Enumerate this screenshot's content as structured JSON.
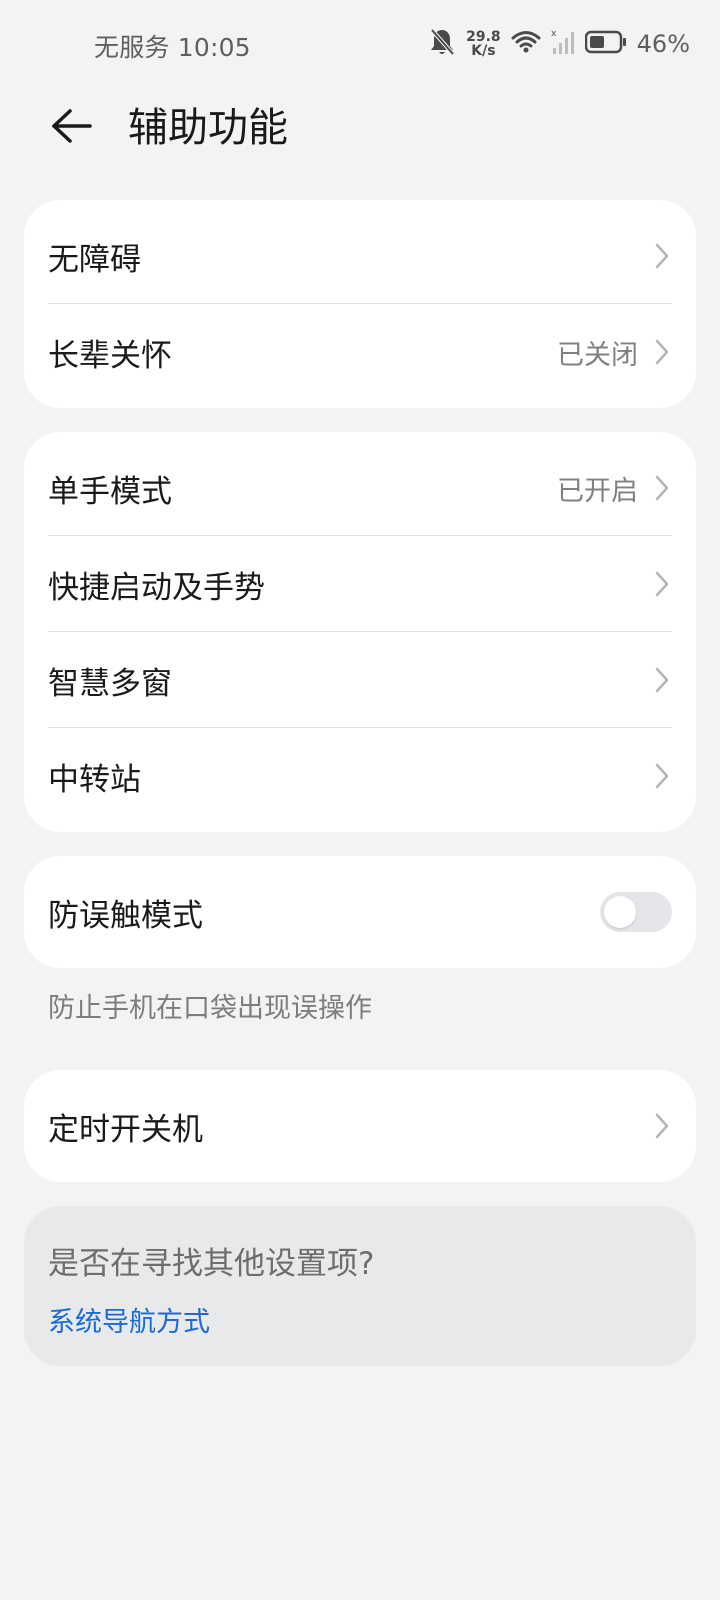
{
  "status_bar": {
    "left_text": "无服务 10:05",
    "net_speed_value": "29.8",
    "net_speed_unit": "K/s",
    "battery_percent": "46%",
    "icons": [
      "bell-muted-icon",
      "wifi-icon",
      "signal-icon",
      "battery-icon"
    ]
  },
  "header": {
    "title": "辅助功能"
  },
  "group1": {
    "items": [
      {
        "label": "无障碍",
        "value": ""
      },
      {
        "label": "长辈关怀",
        "value": "已关闭"
      }
    ]
  },
  "group2": {
    "items": [
      {
        "label": "单手模式",
        "value": "已开启"
      },
      {
        "label": "快捷启动及手势",
        "value": ""
      },
      {
        "label": "智慧多窗",
        "value": ""
      },
      {
        "label": "中转站",
        "value": ""
      }
    ]
  },
  "group3": {
    "label": "防误触模式",
    "toggle_on": false,
    "hint": "防止手机在口袋出现误操作"
  },
  "group4": {
    "label": "定时开关机"
  },
  "suggestion": {
    "title": "是否在寻找其他设置项?",
    "link": "系统导航方式"
  },
  "colors": {
    "background": "#f1f3f5",
    "card": "#ffffff",
    "link": "#1a6bd6",
    "secondary_text": "#808080"
  }
}
